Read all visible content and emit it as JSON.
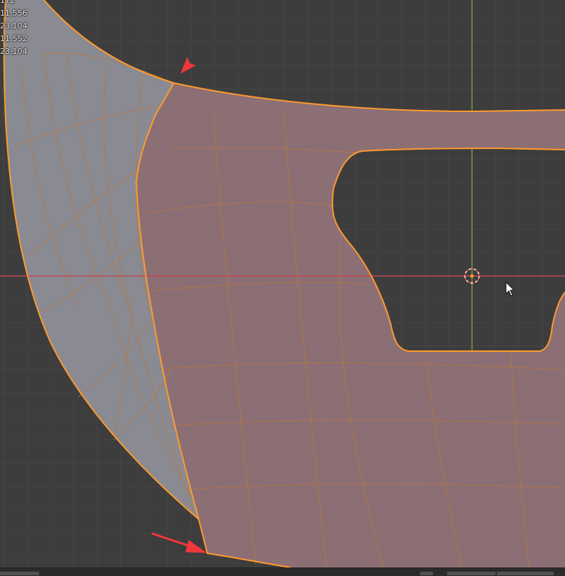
{
  "viewport": {
    "stats_lines": [
      "172",
      "11,556",
      "23,104",
      "11,552",
      "23,104"
    ]
  },
  "colors": {
    "background": "#3d3d3d",
    "grid_minor": "#454545",
    "grid_major": "#4a4a4a",
    "x_axis": "#c04a57",
    "y_axis": "#7f9a3a",
    "selected_face": "#8c6f74",
    "unselected_face": "#8a8a92",
    "wire_edge": "#b8783a",
    "selected_edge": "#ff9a2e",
    "annotation_arrow": "#f0383a"
  },
  "icons": {
    "origin": "origin-marker-icon",
    "cursor_3d": "3d-cursor-icon",
    "mouse_pointer": "mouse-pointer-icon",
    "arrow": "annotation-arrow-icon"
  }
}
